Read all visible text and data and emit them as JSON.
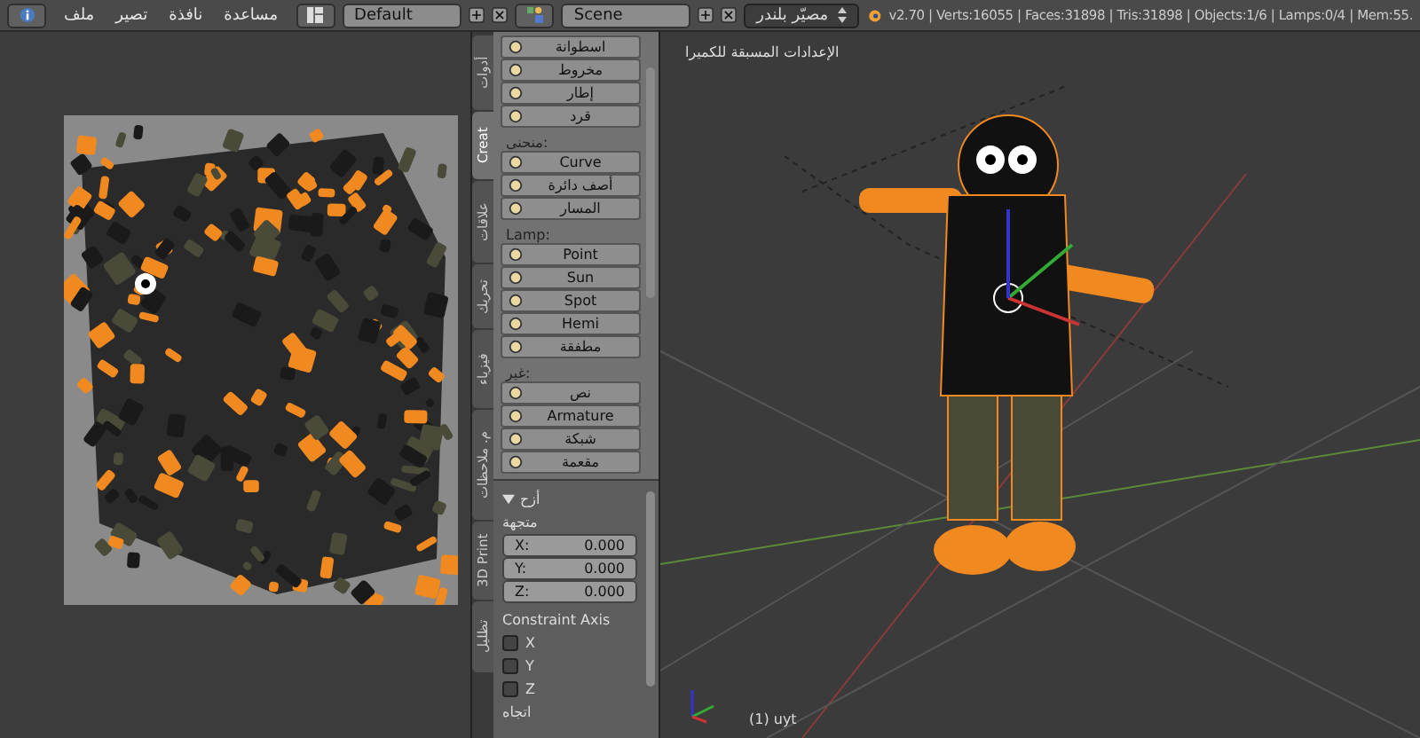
{
  "top_bar": {
    "menus": [
      "مساعدة",
      "نافذة",
      "تصير",
      "ملف"
    ],
    "layout": "Default",
    "scene": "Scene",
    "engine": "مصيّر بلندر",
    "stats": "v2.70 | Verts:16055 | Faces:31898 | Tris:31898 | Objects:1/6 | Lamps:0/4 | Mem:55."
  },
  "tool_tabs": [
    {
      "label": "أدوات",
      "selected": false
    },
    {
      "label": "Creat",
      "selected": true
    },
    {
      "label": "علاقات",
      "selected": false
    },
    {
      "label": "تحريك",
      "selected": false
    },
    {
      "label": "فيزياء",
      "selected": false
    },
    {
      "label": "م. ملاحظات",
      "selected": false
    },
    {
      "label": "3D Print",
      "selected": false
    },
    {
      "label": "تظليل",
      "selected": false
    }
  ],
  "tool_panel": {
    "sections": [
      {
        "buttons": [
          "اسطوانة",
          "مخروط",
          "إطار",
          "قرد"
        ]
      },
      {
        "heading": "منحنى:",
        "buttons": [
          "Curve",
          "أصف دائرة",
          "المسار"
        ]
      },
      {
        "heading": "Lamp:",
        "buttons": [
          "Point",
          "Sun",
          "Spot",
          "Hemi",
          "مطفقة"
        ]
      },
      {
        "heading": "غير:",
        "buttons": [
          "نص",
          "Armature",
          "شبكة",
          "مقعمة"
        ]
      }
    ]
  },
  "operator_panel": {
    "title": "أزح",
    "expanded": true,
    "vector_label": "متجهة",
    "fields": [
      {
        "label": "X:",
        "value": "0.000"
      },
      {
        "label": "Y:",
        "value": "0.000"
      },
      {
        "label": "Z:",
        "value": "0.000"
      }
    ],
    "constraint_label": "Constraint Axis",
    "axes": [
      {
        "label": "X",
        "checked": false
      },
      {
        "label": "Y",
        "checked": false
      },
      {
        "label": "Z",
        "checked": false
      }
    ],
    "orientation_label": "اتجاه"
  },
  "viewport": {
    "title": "الإعدادات المسبقة للكميرا",
    "object_label": "(1) uyt"
  }
}
